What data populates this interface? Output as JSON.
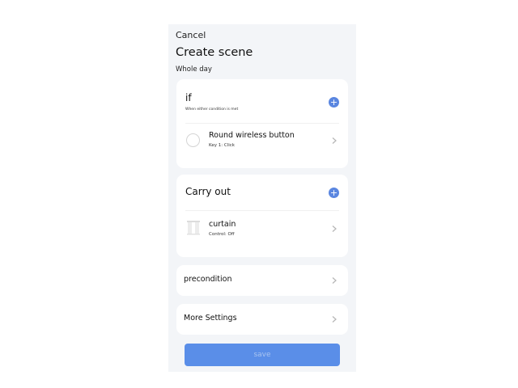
{
  "header": {
    "cancel_label": "Cancel",
    "title": "Create scene",
    "subtitle": "Whole day"
  },
  "if_section": {
    "title": "if",
    "note": "When either condition is met",
    "add_icon": "plus-icon",
    "condition": {
      "title": "Round wireless button",
      "detail": "Key 1: Click",
      "icon": "radio-circle-icon"
    }
  },
  "carry_out_section": {
    "title": "Carry out",
    "add_icon": "plus-icon",
    "action": {
      "title": "curtain",
      "detail": "Control: Off",
      "icon": "curtain-icon"
    }
  },
  "precondition": {
    "label": "precondition"
  },
  "more_settings": {
    "label": "More Settings"
  },
  "save_button": {
    "label": "save"
  },
  "colors": {
    "accent": "#5a86e0",
    "save_button_bg": "#5a8ee8",
    "panel_bg": "#f3f5f8"
  }
}
